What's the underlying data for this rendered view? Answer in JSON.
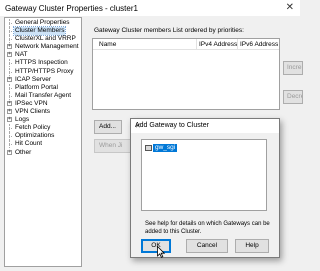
{
  "window": {
    "title": "Gateway Cluster Properties - cluster1"
  },
  "tree": {
    "items": [
      {
        "label": "General Properties",
        "expandable": false,
        "selected": false
      },
      {
        "label": "Cluster Members",
        "expandable": false,
        "selected": true
      },
      {
        "label": "ClusterXL and VRRP",
        "expandable": false,
        "selected": false
      },
      {
        "label": "Network Management",
        "expandable": true,
        "selected": false
      },
      {
        "label": "NAT",
        "expandable": true,
        "selected": false
      },
      {
        "label": "HTTPS Inspection",
        "expandable": false,
        "selected": false
      },
      {
        "label": "HTTP/HTTPS Proxy",
        "expandable": false,
        "selected": false
      },
      {
        "label": "ICAP Server",
        "expandable": true,
        "selected": false
      },
      {
        "label": "Platform Portal",
        "expandable": false,
        "selected": false
      },
      {
        "label": "Mail Transfer Agent",
        "expandable": false,
        "selected": false
      },
      {
        "label": "IPSec VPN",
        "expandable": true,
        "selected": false
      },
      {
        "label": "VPN Clients",
        "expandable": true,
        "selected": false
      },
      {
        "label": "Logs",
        "expandable": true,
        "selected": false
      },
      {
        "label": "Fetch Policy",
        "expandable": false,
        "selected": false
      },
      {
        "label": "Optimizations",
        "expandable": false,
        "selected": false
      },
      {
        "label": "Hit Count",
        "expandable": false,
        "selected": false
      },
      {
        "label": "Other",
        "expandable": true,
        "selected": false
      }
    ]
  },
  "members": {
    "description": "Gateway Cluster members List ordered by priorities:",
    "columns": [
      "Name",
      "IPv4 Address",
      "IPv6 Address"
    ],
    "side_buttons": [
      "Incre",
      "Decre"
    ],
    "add_label": "Add...",
    "when_label": "When Ji"
  },
  "dialog": {
    "title": "Add Gateway to Cluster",
    "gateway_item": "gw_sgi",
    "help_text": "See help for details on which Gateways can be added to this Cluster.",
    "ok_label": "OK",
    "cancel_label": "Cancel",
    "help_label": "Help"
  },
  "colors": {
    "selection": "#0078d7",
    "tree_selection": "#cde3f7"
  }
}
